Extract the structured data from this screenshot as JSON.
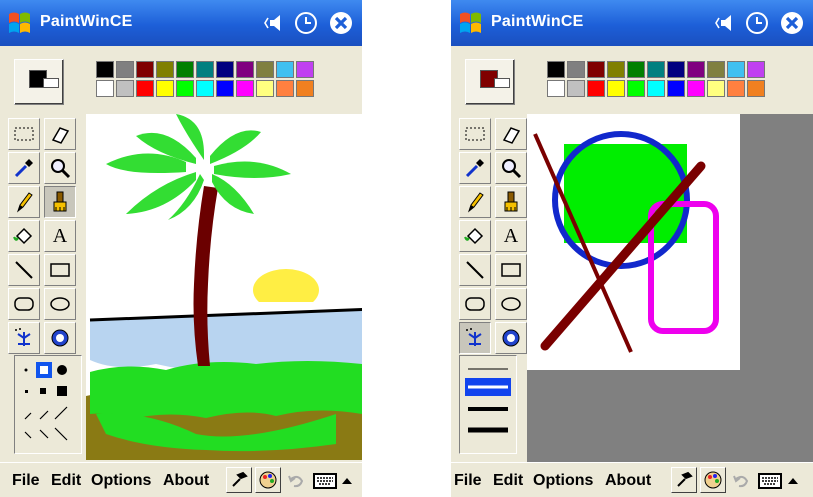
{
  "app_title": "PaintWinCE",
  "palette": [
    "#000000",
    "#808080",
    "#800000",
    "#808000",
    "#008000",
    "#008080",
    "#000080",
    "#800080",
    "#808040",
    "#40c0f0",
    "#c040f0",
    "#ffffff",
    "#c0c0c0",
    "#ff0000",
    "#ffff00",
    "#00ff00",
    "#00ffff",
    "#0000ff",
    "#ff00ff",
    "#ffff80",
    "#ff8040",
    "#f08020"
  ],
  "left": {
    "current_color": "#000000",
    "line_color": "#000000"
  },
  "right": {
    "current_color": "#800000",
    "line_color": "#800000"
  },
  "tools": [
    {
      "name": "select-tool"
    },
    {
      "name": "eraser-tool"
    },
    {
      "name": "color-picker-tool"
    },
    {
      "name": "magnifier-tool"
    },
    {
      "name": "pencil-tool"
    },
    {
      "name": "brush-tool"
    },
    {
      "name": "fill-tool"
    },
    {
      "name": "text-tool",
      "glyph": "A"
    },
    {
      "name": "line-tool"
    },
    {
      "name": "rectangle-tool"
    },
    {
      "name": "rounded-rectangle-tool"
    },
    {
      "name": "ellipse-tool"
    },
    {
      "name": "airbrush-tool"
    },
    {
      "name": "stamp-tool"
    }
  ],
  "menu": {
    "file": "File",
    "edit": "Edit",
    "options": "Options",
    "about": "About"
  }
}
